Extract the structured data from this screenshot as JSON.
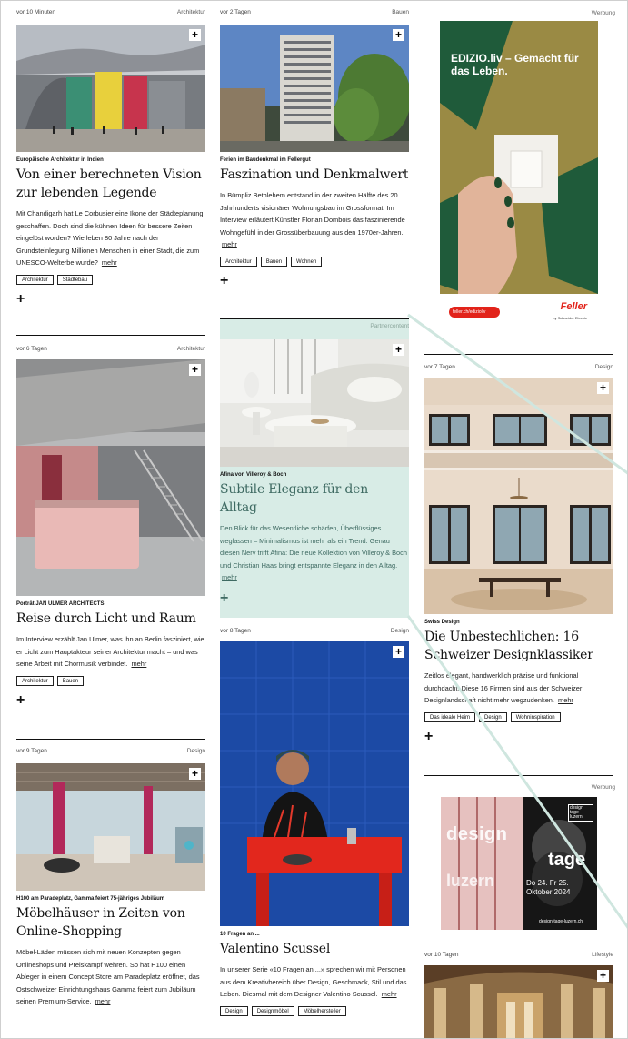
{
  "cards": [
    {
      "id": "c1",
      "meta_time": "vor 10 Minuten",
      "meta_cat": "Architektur",
      "kicker": "Europäische Architektur in Indien",
      "title": "Von einer berechneten Vision zur lebenden Legende",
      "teaser": "Mit Chandigarh hat Le Corbusier eine Ikone der Städteplanung geschaffen. Doch sind die kühnen Ideen für bessere Zeiten eingelöst worden? Wie leben 80 Jahre nach der Grundsteinlegung Millionen Menschen in einer Stadt, die zum UNESCO-Welterbe wurde?",
      "more": "mehr",
      "tags": [
        "Architektur",
        "Städtebau"
      ]
    },
    {
      "id": "c2",
      "meta_time": "vor 2 Tagen",
      "meta_cat": "Bauen",
      "kicker": "Ferien im Baudenkmal im Fellergut",
      "title": "Faszination und Denkmalwert",
      "teaser": "In Bümpliz Bethlehem entstand in der zweiten Hälfte des 20. Jahrhunderts visionärer Wohnungsbau im Grossformat. Im Interview erläutert Künstler Florian Dombois das faszinierende Wohngefühl in der Grossüberbauung aus den 1970er-Jahren.",
      "more": "mehr",
      "tags": [
        "Architektur",
        "Bauen",
        "Wohnen"
      ]
    },
    {
      "id": "c3",
      "meta_time": "vor 6 Tagen",
      "meta_cat": "Architektur",
      "kicker": "Porträt JAN ULMER ARCHITECTS",
      "title": "Reise durch Licht und Raum",
      "teaser": "Im Interview erzählt Jan Ulmer, was ihn an Berlin fasziniert, wie er Licht zum Hauptakteur seiner Architektur macht – und was seine Arbeit mit Chormusik verbindet.",
      "more": "mehr",
      "tags": [
        "Architektur",
        "Bauen"
      ]
    },
    {
      "id": "c4",
      "meta_time": "",
      "meta_cat": "Partnercontent",
      "kicker": "Afina von Villeroy & Boch",
      "title": "Subtile Eleganz für den Alltag",
      "teaser": "Den Blick für das Wesentliche schärfen, Überflüssiges weglassen – Minimalismus ist mehr als ein Trend. Genau diesen Nerv trifft Afina: Die neue Kollektion von Villeroy & Boch und Christian Haas bringt entspannte Eleganz in den Alltag.",
      "more": "mehr",
      "tags": []
    },
    {
      "id": "c5",
      "meta_time": "vor 7 Tagen",
      "meta_cat": "Design",
      "kicker": "Swiss Design",
      "title": "Die Unbestechlichen: 16 Schweizer Designklassiker",
      "teaser": "Zeitlos elegant, handwerklich präzise und funktional durchdacht: Diese 16 Firmen sind aus der Schweizer Designlandschaft nicht mehr wegzudenken.",
      "more": "mehr",
      "tags": [
        "Das ideale Heim",
        "Design",
        "Wohninspiration"
      ]
    },
    {
      "id": "c6",
      "meta_time": "vor 9 Tagen",
      "meta_cat": "Design",
      "kicker": "H100 am Paradeplatz, Gamma feiert 75-jähriges Jubiläum",
      "title": "Möbelhäuser in Zeiten von Online-Shopping",
      "teaser": "Möbel-Läden müssen sich mit neuen Konzepten gegen Onlineshops und Preiskampf wehren. So hat H100 einen Ableger in einem Concept Store am Paradeplatz eröffnet, das Ostschweizer Einrichtungshaus Gamma feiert zum Jubiläum seinen Premium-Service.",
      "more": "mehr",
      "tags": []
    },
    {
      "id": "c7",
      "meta_time": "vor 8 Tagen",
      "meta_cat": "Design",
      "kicker": "10 Fragen an ...",
      "title": "Valentino Scussel",
      "teaser": "In unserer Serie «10 Fragen an ...» sprechen wir mit Personen aus dem Kreativbereich über Design, Geschmack, Stil und das Leben. Diesmal mit dem Designer Valentino Scussel.",
      "more": "mehr",
      "tags": [
        "Design",
        "Designmöbel",
        "Möbelhersteller"
      ]
    },
    {
      "id": "c8",
      "meta_time": "vor 10 Tagen",
      "meta_cat": "Lifestyle",
      "kicker": "",
      "title": "",
      "teaser": "",
      "more": "",
      "tags": []
    }
  ],
  "ads": {
    "label": "Werbung",
    "feller_headline": "EDIZIO.liv – Gemacht für das Leben.",
    "feller_url": "feller.ch/edizioliv",
    "feller_brand": "Feller",
    "feller_sub": "by Schneider Electric",
    "design_logo": "design tage luzern",
    "design_word1": "design",
    "design_word2": "tage",
    "design_word3": "luzern",
    "design_dates": "Do 24. Fr 25. Oktober 2024",
    "design_url": "design-tage-luzern.ch"
  },
  "plus_symbol": "+",
  "colors": {
    "partner_bg": "#d8ece6",
    "feller_red": "#e2231a",
    "line_teal": "#cfe6df"
  },
  "icons": {
    "add": "plus-icon"
  }
}
